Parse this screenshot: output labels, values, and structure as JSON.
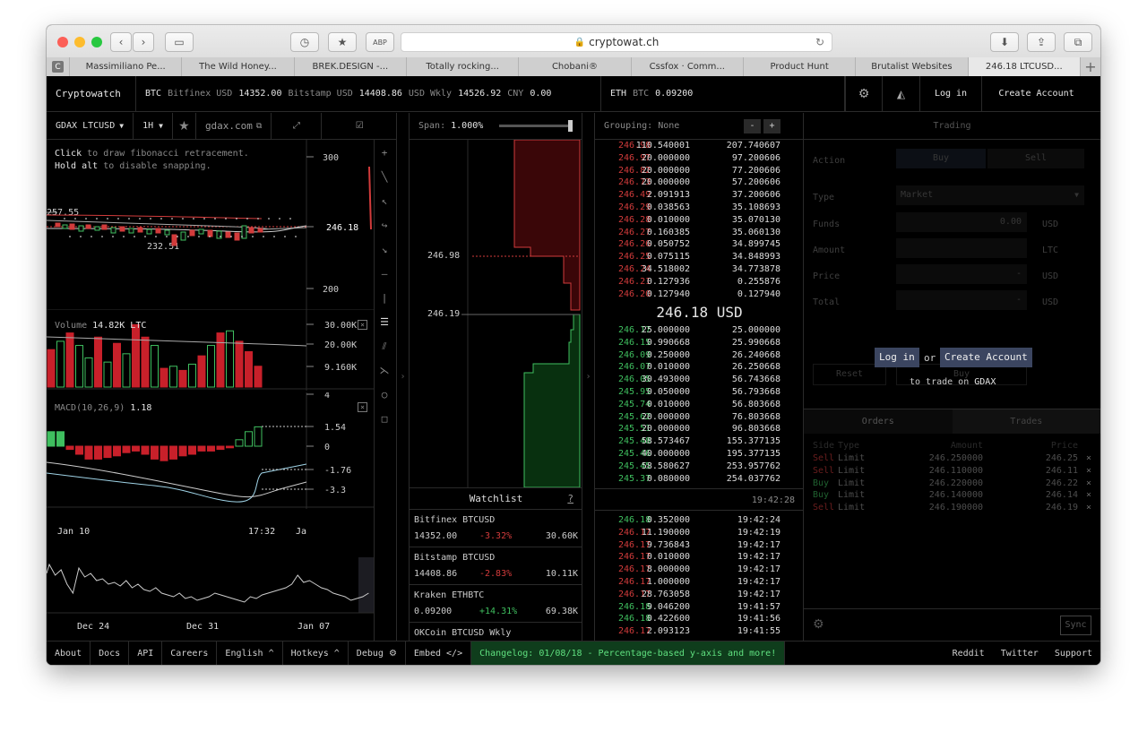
{
  "browser": {
    "url": "cryptowat.ch",
    "tabs": [
      {
        "label": "Massimiliano Pe..."
      },
      {
        "label": "The Wild Honey..."
      },
      {
        "label": "BREK.DESIGN -..."
      },
      {
        "label": "Totally rocking..."
      },
      {
        "label": "Chobani®"
      },
      {
        "label": "Cssfox · Comm..."
      },
      {
        "label": "Product Hunt"
      },
      {
        "label": "Brutalist Websites"
      },
      {
        "label": "246.18 LTCUSD..."
      }
    ]
  },
  "topbar": {
    "brand": "Cryptowatch",
    "btc_label": "BTC",
    "bitfinex": "Bitfinex USD",
    "bitfinex_val": "14352.00",
    "bitstamp": "Bitstamp USD",
    "bitstamp_val": "14408.86",
    "usdwkly": "USD Wkly",
    "usdwkly_val": "14526.92",
    "cny": "CNY",
    "cny_val": "0.00",
    "eth_label": "ETH",
    "eth_btc": "BTC",
    "eth_btc_val": "0.09200",
    "login": "Log in",
    "create": "Create Account"
  },
  "chart": {
    "pair": "GDAX LTCUSD",
    "interval": "1H",
    "source": "gdax.com",
    "hint1_a": "Click",
    "hint1_b": " to draw fibonacci retracement.",
    "hint2_a": "Hold alt",
    "hint2_b": " to disable snapping.",
    "price_axis": [
      "300",
      "246.18",
      "200"
    ],
    "price_high_label": "257.55",
    "price_low_label": "232.51",
    "volume_label": "Volume",
    "volume_value": "14.82K LTC",
    "volume_axis": [
      "30.00K",
      "20.00K",
      "9.160K"
    ],
    "macd_label": "MACD(10,26,9)",
    "macd_value": "1.18",
    "macd_axis": [
      "4",
      "1.54",
      "0",
      "-1.76",
      "-3.3"
    ],
    "time_axis": [
      "Jan 10",
      "17:32",
      "Ja"
    ],
    "overview_axis": [
      "Dec 24",
      "Dec 31",
      "Jan 07"
    ],
    "volume_bars": [
      {
        "v": 18,
        "up": false
      },
      {
        "v": 22,
        "up": true
      },
      {
        "v": 26,
        "up": false
      },
      {
        "v": 20,
        "up": true
      },
      {
        "v": 14,
        "up": true
      },
      {
        "v": 24,
        "up": false
      },
      {
        "v": 12,
        "up": true
      },
      {
        "v": 21,
        "up": false
      },
      {
        "v": 16,
        "up": true
      },
      {
        "v": 30,
        "up": false
      },
      {
        "v": 24,
        "up": false
      },
      {
        "v": 20,
        "up": true
      },
      {
        "v": 9,
        "up": false
      },
      {
        "v": 10,
        "up": true
      },
      {
        "v": 8,
        "up": false
      },
      {
        "v": 11,
        "up": true
      },
      {
        "v": 15,
        "up": false
      },
      {
        "v": 20,
        "up": true
      },
      {
        "v": 26,
        "up": false
      },
      {
        "v": 27,
        "up": true
      },
      {
        "v": 22,
        "up": false
      },
      {
        "v": 17,
        "up": false
      },
      {
        "v": 10,
        "up": false
      }
    ],
    "macd_hist": [
      0.9,
      0.9,
      -0.2,
      -0.5,
      -0.8,
      -0.8,
      -0.7,
      -0.6,
      -0.4,
      -0.3,
      -0.5,
      -0.8,
      -0.9,
      -0.8,
      -0.6,
      -0.5,
      -0.3,
      -0.3,
      -0.2,
      -0.1,
      0.4,
      0.9,
      1.2
    ]
  },
  "depth": {
    "span_label": "Span:",
    "span_value": "1.000%",
    "ask_price": "246.98",
    "bid_price": "246.19"
  },
  "watchlist": {
    "title": "Watchlist",
    "help": "?",
    "items": [
      {
        "name": "Bitfinex BTCUSD",
        "price": "14352.00",
        "change": "-3.32%",
        "vol": "30.60K",
        "up": false
      },
      {
        "name": "Bitstamp BTCUSD",
        "price": "14408.86",
        "change": "-2.83%",
        "vol": "10.11K",
        "up": false
      },
      {
        "name": "Kraken ETHBTC",
        "price": "0.09200",
        "change": "+14.31%",
        "vol": "69.38K",
        "up": true
      },
      {
        "name": "OKCoin BTCUSD Wkly",
        "price": "",
        "change": "",
        "vol": "",
        "up": false
      }
    ]
  },
  "orderbook": {
    "grouping_label": "Grouping:",
    "grouping_value": "None",
    "minus": "-",
    "plus": "+",
    "mid": "246.18 USD",
    "asks": [
      [
        "246.98",
        "110.540001",
        "207.740607"
      ],
      [
        "246.97",
        "20.000000",
        "97.200606"
      ],
      [
        "246.82",
        "20.000000",
        "77.200606"
      ],
      [
        "246.73",
        "20.000000",
        "57.200606"
      ],
      [
        "246.49",
        "2.091913",
        "37.200606"
      ],
      [
        "246.29",
        "0.038563",
        "35.108693"
      ],
      [
        "246.28",
        "0.010000",
        "35.070130"
      ],
      [
        "246.27",
        "0.160385",
        "35.060130"
      ],
      [
        "246.26",
        "0.050752",
        "34.899745"
      ],
      [
        "246.25",
        "0.075115",
        "34.848993"
      ],
      [
        "246.24",
        "34.518002",
        "34.773878"
      ],
      [
        "246.21",
        "0.127936",
        "0.255876"
      ],
      [
        "246.20",
        "0.127940",
        "0.127940"
      ]
    ],
    "bids": [
      [
        "246.17",
        "25.000000",
        "25.000000"
      ],
      [
        "246.15",
        "0.990668",
        "25.990668"
      ],
      [
        "246.09",
        "0.250000",
        "26.240668"
      ],
      [
        "246.07",
        "0.010000",
        "26.250668"
      ],
      [
        "246.05",
        "30.493000",
        "56.743668"
      ],
      [
        "245.95",
        "0.050000",
        "56.793668"
      ],
      [
        "245.74",
        "0.010000",
        "56.803668"
      ],
      [
        "245.62",
        "20.000000",
        "76.803668"
      ],
      [
        "245.51",
        "20.000000",
        "96.803668"
      ],
      [
        "245.48",
        "58.573467",
        "155.377135"
      ],
      [
        "245.46",
        "40.000000",
        "195.377135"
      ],
      [
        "245.45",
        "58.580627",
        "253.957762"
      ],
      [
        "245.37",
        "0.080000",
        "254.037762"
      ]
    ],
    "book_time": "19:42:28",
    "trades": [
      [
        "246.18",
        "0.352000",
        "19:42:24",
        true
      ],
      [
        "246.17",
        "11.190000",
        "19:42:19",
        false
      ],
      [
        "246.17",
        "9.736843",
        "19:42:17",
        false
      ],
      [
        "246.17",
        "0.010000",
        "19:42:17",
        false
      ],
      [
        "246.17",
        "8.000000",
        "19:42:17",
        false
      ],
      [
        "246.17",
        "1.000000",
        "19:42:17",
        false
      ],
      [
        "246.17",
        "28.763058",
        "19:42:17",
        false
      ],
      [
        "246.18",
        "9.046200",
        "19:41:57",
        true
      ],
      [
        "246.18",
        "0.422600",
        "19:41:56",
        true
      ],
      [
        "246.17",
        "2.093123",
        "19:41:55",
        false
      ]
    ]
  },
  "trading": {
    "title": "Trading",
    "action_label": "Action",
    "buy": "Buy",
    "sell": "Sell",
    "type_label": "Type",
    "type_value": "Market",
    "funds_label": "Funds",
    "funds_value": "0.00",
    "funds_unit": "USD",
    "amount_label": "Amount",
    "amount_unit": "LTC",
    "price_label": "Price",
    "price_value": "-",
    "price_unit": "USD",
    "total_label": "Total",
    "total_value": "-",
    "total_unit": "USD",
    "reset": "Reset",
    "buy_btn": "Buy",
    "overlay_login": "Log in",
    "overlay_or": "or",
    "overlay_create": "Create Account",
    "overlay_to": "to trade on",
    "overlay_exchange": "GDAX",
    "orders_tab": "Orders",
    "trades_tab": "Trades",
    "cols": [
      "Side",
      "Type",
      "Amount",
      "Price"
    ],
    "orders": [
      [
        "Sell",
        "Limit",
        "246.250000",
        "246.25"
      ],
      [
        "Sell",
        "Limit",
        "246.110000",
        "246.11"
      ],
      [
        "Buy",
        "Limit",
        "246.220000",
        "246.22"
      ],
      [
        "Buy",
        "Limit",
        "246.140000",
        "246.14"
      ],
      [
        "Sell",
        "Limit",
        "246.190000",
        "246.19"
      ]
    ],
    "sync": "Sync"
  },
  "footer": {
    "about": "About",
    "docs": "Docs",
    "api": "API",
    "careers": "Careers",
    "english": "English ^",
    "hotkeys": "Hotkeys ^",
    "debug": "Debug",
    "embed": "Embed </>",
    "changelog": "Changelog: 01/08/18 - Percentage-based y-axis and more!",
    "reddit": "Reddit",
    "twitter": "Twitter",
    "support": "Support"
  },
  "colors": {
    "up": "#3fbf5f",
    "down": "#d23b3b",
    "panel": "#000000",
    "border": "#2a2a2a",
    "accent": "#1e8a3a"
  }
}
